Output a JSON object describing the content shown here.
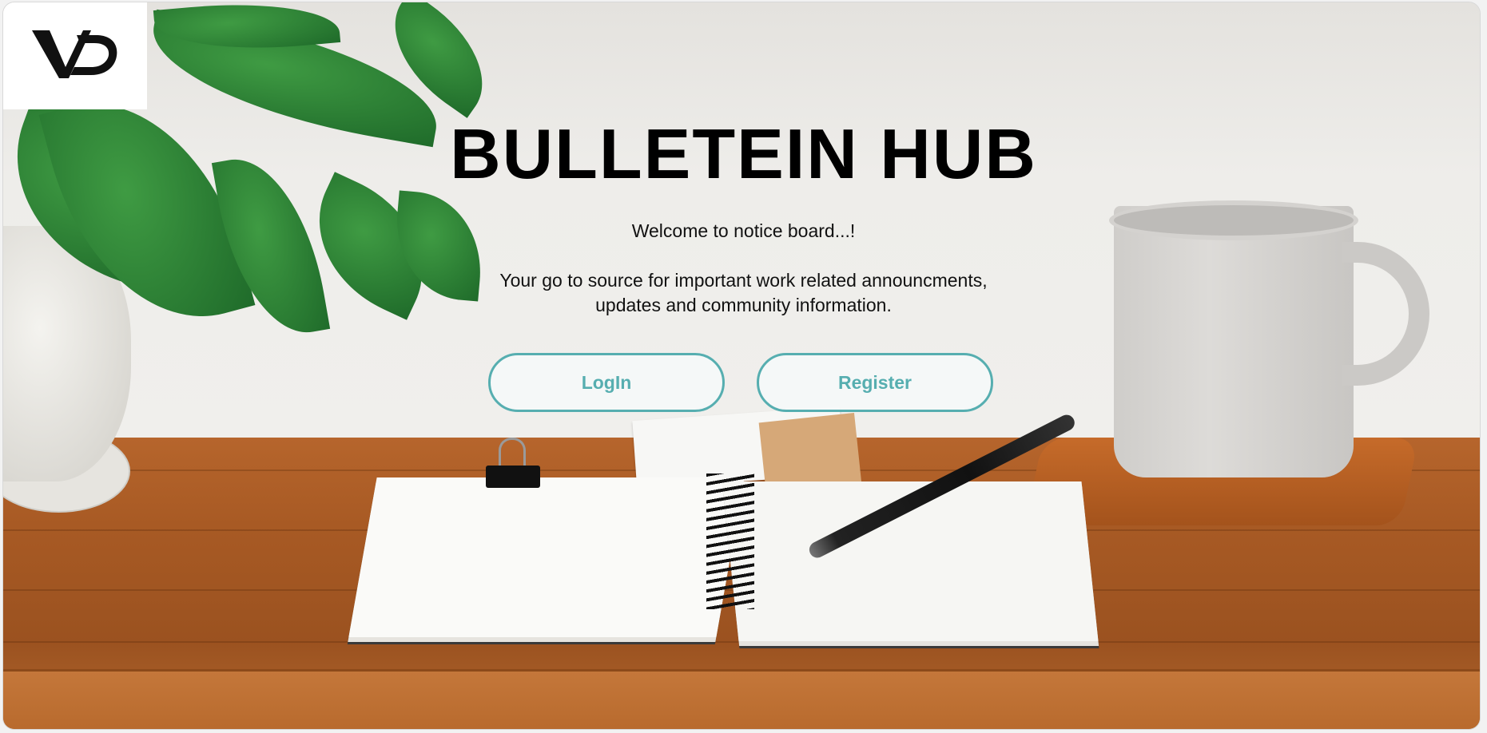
{
  "logo": {
    "text": "VD",
    "icon": "vd-logo-icon"
  },
  "hero": {
    "title": "BULLETEIN HUB",
    "welcome": "Welcome to notice board...!",
    "description_line1": "Your go to source for important work related announcments,",
    "description_line2": "updates and community information."
  },
  "actions": {
    "login_label": "LogIn",
    "register_label": "Register"
  },
  "colors": {
    "accent": "#56aeb0",
    "title": "#000000"
  }
}
